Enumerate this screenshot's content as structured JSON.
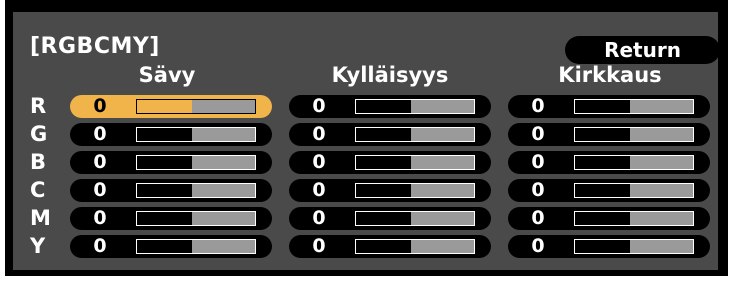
{
  "panel": {
    "title": "[RGBCMY]",
    "return_label": "Return"
  },
  "columns": [
    "Sävy",
    "Kylläisyys",
    "Kirkkaus"
  ],
  "rows": [
    {
      "label": "R",
      "values": [
        "0",
        "0",
        "0"
      ]
    },
    {
      "label": "G",
      "values": [
        "0",
        "0",
        "0"
      ]
    },
    {
      "label": "B",
      "values": [
        "0",
        "0",
        "0"
      ]
    },
    {
      "label": "C",
      "values": [
        "0",
        "0",
        "0"
      ]
    },
    {
      "label": "M",
      "values": [
        "0",
        "0",
        "0"
      ]
    },
    {
      "label": "Y",
      "values": [
        "0",
        "0",
        "0"
      ]
    }
  ],
  "selected": {
    "row": "R",
    "column": "Sävy"
  },
  "colors": {
    "highlight": "#f0b44a",
    "panel_bg": "#4a4a4a",
    "control_bg": "#000000",
    "track": "#9a9a9a"
  }
}
